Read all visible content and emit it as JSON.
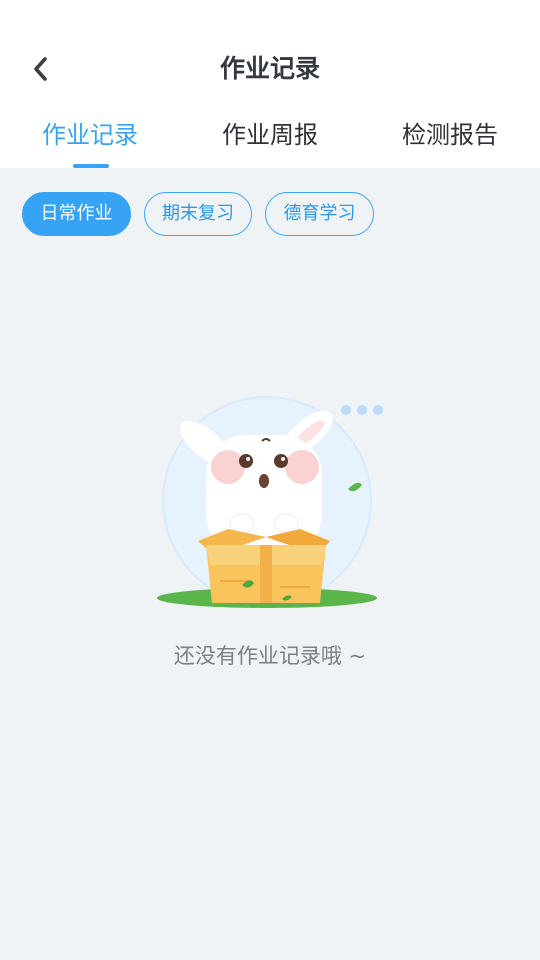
{
  "header": {
    "title": "作业记录",
    "back_icon": "chevron-left-icon"
  },
  "tabs": [
    {
      "label": "作业记录",
      "active": true
    },
    {
      "label": "作业周报",
      "active": false
    },
    {
      "label": "检测报告",
      "active": false
    }
  ],
  "filters": [
    {
      "label": "日常作业",
      "active": true
    },
    {
      "label": "期末复习",
      "active": false
    },
    {
      "label": "德育学习",
      "active": false
    }
  ],
  "empty_state": {
    "illustration": "rabbit-in-box-illustration",
    "message": "还没有作业记录哦 ~"
  },
  "colors": {
    "accent": "#36a3f4",
    "background": "#f0f3f5",
    "title_text": "#333740",
    "muted_text": "#7a8088"
  }
}
